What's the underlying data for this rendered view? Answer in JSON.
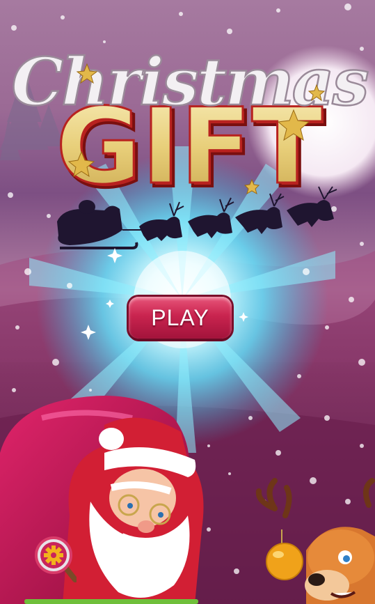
{
  "title": {
    "script_word": "Christmas",
    "main_word": "GIFT"
  },
  "play_button": {
    "label": "PLAY"
  },
  "icons": {
    "settings": "gear-icon",
    "santa_sleigh": "sleigh-silhouette",
    "santa": "santa-character",
    "reindeer": "reindeer-character",
    "ornament": "ornament-icon"
  },
  "colors": {
    "play_button": "#c9244f",
    "title_gold": "#e8cf7a",
    "title_outline": "#b8221f",
    "sky_top": "#a67aa0",
    "glow": "#3fe0ff"
  }
}
